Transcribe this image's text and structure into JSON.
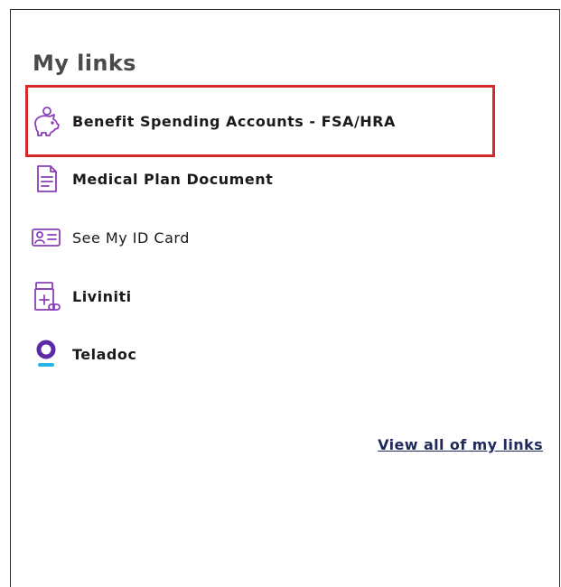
{
  "widget": {
    "title": "My links",
    "links": [
      {
        "label": "Benefit Spending Accounts - FSA/HRA",
        "icon": "piggy-bank-icon",
        "highlighted": true
      },
      {
        "label": "Medical Plan Document",
        "icon": "document-icon"
      },
      {
        "label": "See My ID Card",
        "icon": "id-card-icon"
      },
      {
        "label": "Liviniti",
        "icon": "pharmacy-bottle-icon"
      },
      {
        "label": "Teladoc",
        "icon": "teladoc-logo-icon"
      }
    ],
    "view_all_label": "View all of my links"
  },
  "colors": {
    "icon_purple": "#8a3fb8",
    "teladoc_purple": "#5b2aa6",
    "teladoc_cyan": "#27b3e3",
    "highlight_red": "#d42a2e",
    "link_navy": "#1f2a5c"
  }
}
